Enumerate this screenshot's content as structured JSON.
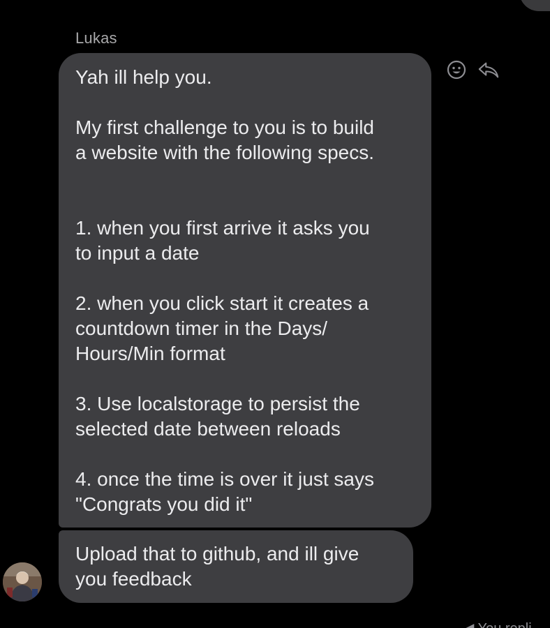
{
  "conversation": {
    "sender_name": "Lukas",
    "messages": [
      {
        "lines": [
          "Yah ill help you.",
          "",
          "My first challenge to you is to build",
          "a website with the following specs.",
          "",
          "",
          "1. when you first arrive it asks you",
          "to input a date",
          "",
          "2. when you click start it creates a",
          "countdown timer in the Days/",
          "Hours/Min format",
          "",
          "3. Use localstorage to persist the",
          "selected date between reloads",
          "",
          "4. once the time is over it just says",
          "\"Congrats you did it\""
        ]
      },
      {
        "lines": [
          "Upload that to github, and ill give",
          "you feedback"
        ]
      }
    ],
    "reply_indicator": "You repli"
  },
  "actions": {
    "react_icon": "smiley-icon",
    "reply_icon": "reply-arrow-icon"
  },
  "colors": {
    "background": "#000000",
    "bubble": "#3e3e41",
    "text": "#ececee",
    "muted": "#a8a8aa",
    "icon": "#8e8e93"
  }
}
